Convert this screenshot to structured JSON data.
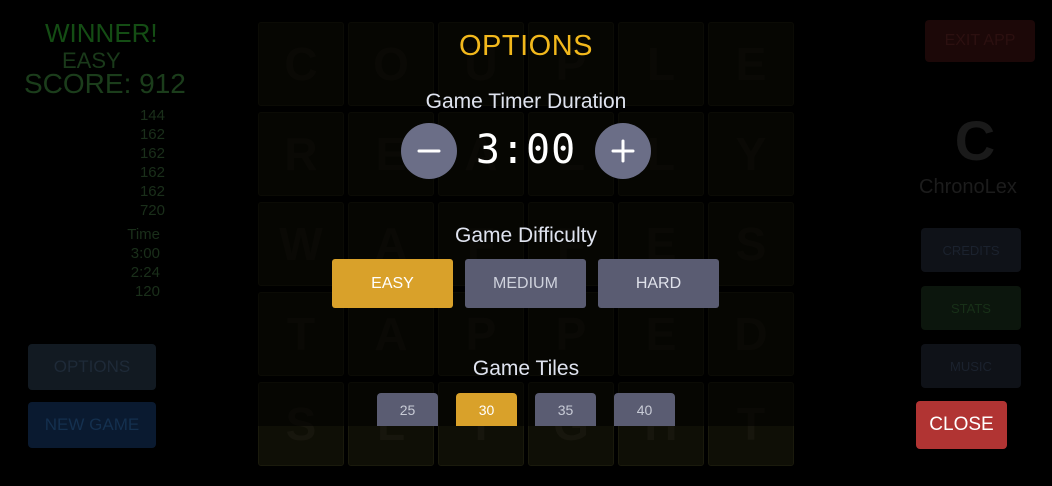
{
  "background": {
    "left": {
      "winner": "WINNER!",
      "mode": "EASY",
      "score": "SCORE: 912",
      "scores": [
        "144",
        "162",
        "162",
        "162",
        "162",
        "720"
      ],
      "time_label": "Time",
      "time_rows": [
        "3:00",
        "2:24",
        "120"
      ],
      "options_label": "OPTIONS",
      "new_game_label": "NEW GAME"
    },
    "board": {
      "rows": [
        [
          "C",
          "O",
          "U",
          "P",
          "L",
          "E"
        ],
        [
          "R",
          "E",
          "A",
          "L",
          "L",
          "Y"
        ],
        [
          "W",
          "A",
          "F",
          "F",
          "E",
          "S"
        ],
        [
          "T",
          "A",
          "P",
          "P",
          "E",
          "D"
        ],
        [
          "S",
          "L",
          "I",
          "G",
          "H",
          "T"
        ]
      ]
    },
    "right": {
      "exit_label": "EXIT APP",
      "logo_letter": "C",
      "logo_name": "ChronoLex",
      "credits_label": "CREDITS",
      "stats_label": "STATS",
      "music_label": "MUSIC"
    }
  },
  "options": {
    "title": "OPTIONS",
    "timer_label": "Game Timer Duration",
    "timer_value": "3:00",
    "minus_icon": "minus-icon",
    "plus_icon": "plus-icon",
    "difficulty_label": "Game Difficulty",
    "difficulty": [
      {
        "label": "EASY",
        "selected": true
      },
      {
        "label": "MEDIUM",
        "selected": false
      },
      {
        "label": "HARD",
        "selected": false
      }
    ],
    "tiles_label": "Game Tiles",
    "tiles": [
      {
        "label": "25",
        "selected": false
      },
      {
        "label": "30",
        "selected": true
      },
      {
        "label": "35",
        "selected": false
      },
      {
        "label": "40",
        "selected": false
      }
    ],
    "close_label": "CLOSE"
  },
  "colors": {
    "accent": "#f2b81c",
    "selected": "#d9a12a",
    "unselected": "#5a5c72",
    "close": "#b13433"
  }
}
